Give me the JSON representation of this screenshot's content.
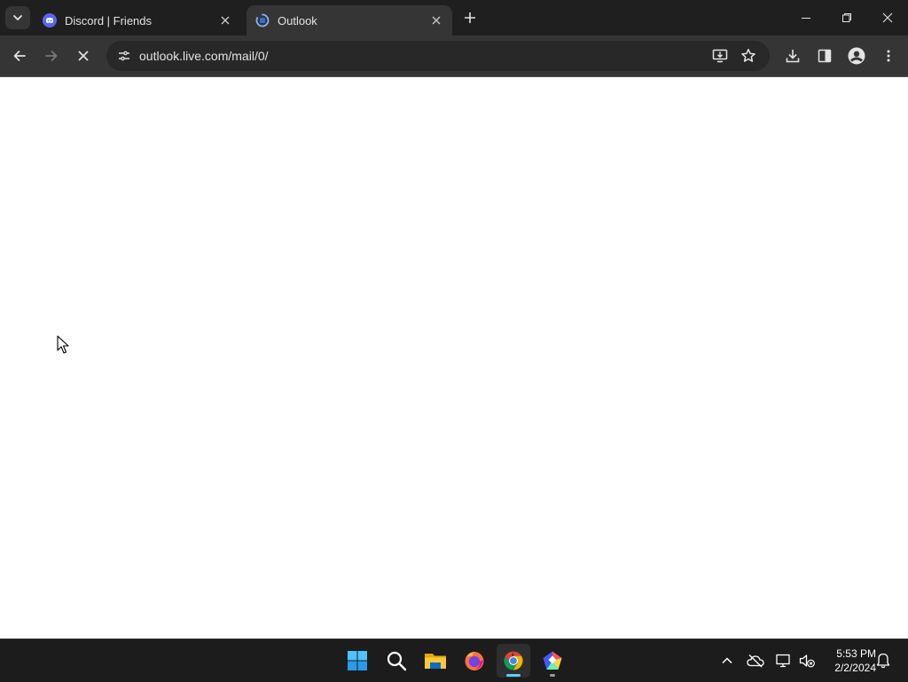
{
  "browser": {
    "tabs": [
      {
        "title": "Discord | Friends",
        "icon": "discord-icon",
        "active": false
      },
      {
        "title": "Outlook",
        "icon": "outlook-loading-icon",
        "active": true
      }
    ],
    "url": "outlook.live.com/mail/0/",
    "accent": "#5865f2"
  },
  "taskbar": {
    "apps": [
      "windows-start-icon",
      "search-icon",
      "file-explorer-icon",
      "firefox-icon",
      "chrome-icon",
      "app-icon"
    ],
    "time": "5:53 PM",
    "date": "2/2/2024"
  }
}
